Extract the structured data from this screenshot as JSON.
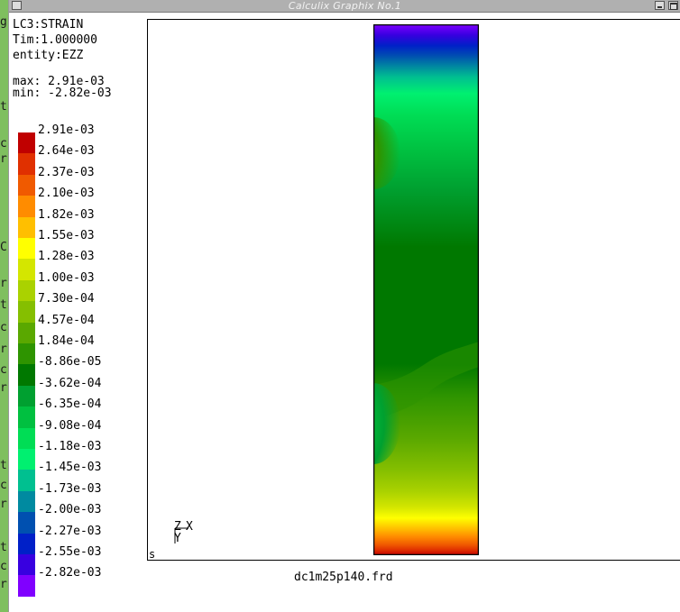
{
  "window": {
    "title": "Calculix Graphix No.1"
  },
  "info": {
    "loadcase": "LC3:STRAIN",
    "time": "Tim:1.000000",
    "entity": "entity:EZZ",
    "max": "max: 2.91e-03",
    "min": "min: -2.82e-03"
  },
  "legend": [
    {
      "label": "2.91e-03",
      "color": "#c00000"
    },
    {
      "label": "2.64e-03",
      "color": "#e03000"
    },
    {
      "label": "2.37e-03",
      "color": "#f05a00"
    },
    {
      "label": "2.10e-03",
      "color": "#ff8c00"
    },
    {
      "label": "1.82e-03",
      "color": "#ffbf00"
    },
    {
      "label": "1.55e-03",
      "color": "#ffff00"
    },
    {
      "label": "1.28e-03",
      "color": "#d4e600"
    },
    {
      "label": "1.00e-03",
      "color": "#aad200"
    },
    {
      "label": "7.30e-04",
      "color": "#85bf00"
    },
    {
      "label": "4.57e-04",
      "color": "#5aa800"
    },
    {
      "label": "1.84e-04",
      "color": "#2e9400"
    },
    {
      "label": "-8.86e-05",
      "color": "#007800"
    },
    {
      "label": "-3.62e-04",
      "color": "#00a030"
    },
    {
      "label": "-6.35e-04",
      "color": "#00c040"
    },
    {
      "label": "-9.08e-04",
      "color": "#00dd55"
    },
    {
      "label": "-1.18e-03",
      "color": "#00f070"
    },
    {
      "label": "-1.45e-03",
      "color": "#00c090"
    },
    {
      "label": "-1.73e-03",
      "color": "#008aa0"
    },
    {
      "label": "-2.00e-03",
      "color": "#0050b0"
    },
    {
      "label": "-2.27e-03",
      "color": "#0020c8"
    },
    {
      "label": "-2.55e-03",
      "color": "#3800e0"
    },
    {
      "label": "-2.82e-03",
      "color": "#8000ff"
    }
  ],
  "axes": {
    "z": "Z",
    "x": "X",
    "y": "Y"
  },
  "viewport": {
    "corner_label": "s"
  },
  "filename": "dc1m25p140.frd",
  "desktop_glyphs": [
    "g",
    "t",
    "c",
    "r",
    "C",
    "r",
    "t",
    "c",
    "r",
    "c",
    "r",
    "t",
    "c",
    "r",
    "t",
    "c",
    "r"
  ]
}
